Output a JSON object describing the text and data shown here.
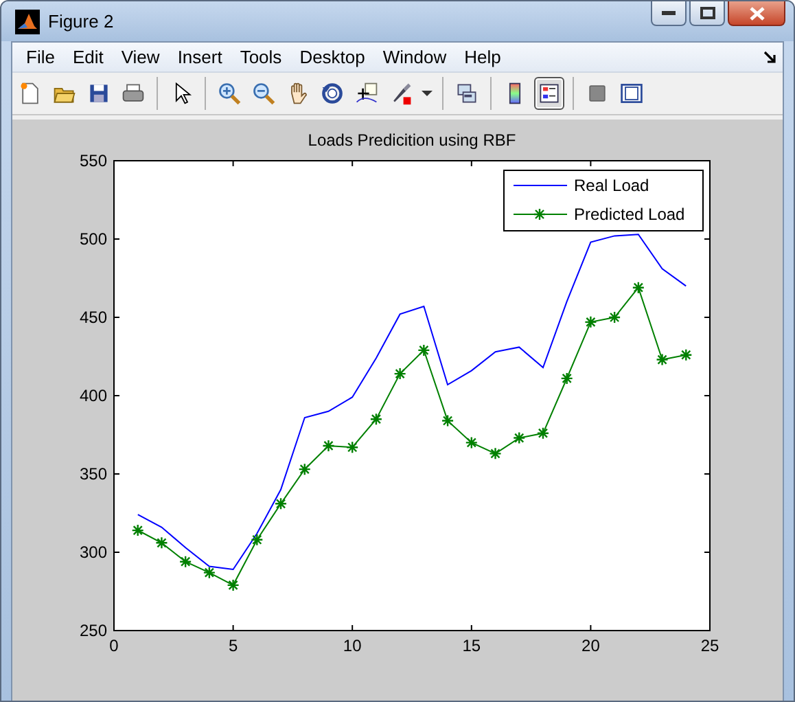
{
  "window": {
    "title": "Figure 2"
  },
  "menu": [
    "File",
    "Edit",
    "View",
    "Insert",
    "Tools",
    "Desktop",
    "Window",
    "Help"
  ],
  "toolbar": [
    {
      "kind": "new",
      "selected": false
    },
    {
      "kind": "open",
      "selected": false
    },
    {
      "kind": "save",
      "selected": false
    },
    {
      "kind": "print",
      "selected": false
    },
    {
      "kind": "sep"
    },
    {
      "kind": "pointer",
      "selected": false
    },
    {
      "kind": "sep"
    },
    {
      "kind": "zoomin",
      "selected": false
    },
    {
      "kind": "zoomout",
      "selected": false
    },
    {
      "kind": "pan",
      "selected": false
    },
    {
      "kind": "rotate",
      "selected": false
    },
    {
      "kind": "cursor",
      "selected": false
    },
    {
      "kind": "brush",
      "selected": false
    },
    {
      "kind": "caret",
      "selected": false
    },
    {
      "kind": "sep"
    },
    {
      "kind": "link",
      "selected": false
    },
    {
      "kind": "sep"
    },
    {
      "kind": "colorbar",
      "selected": false
    },
    {
      "kind": "legend",
      "selected": true
    },
    {
      "kind": "sep"
    },
    {
      "kind": "hide",
      "selected": false
    },
    {
      "kind": "show",
      "selected": false
    }
  ],
  "figure": {
    "chart_data": {
      "type": "line",
      "title": "Loads Predicition using RBF",
      "x": [
        1,
        2,
        3,
        4,
        5,
        6,
        7,
        8,
        9,
        10,
        11,
        12,
        13,
        14,
        15,
        16,
        17,
        18,
        19,
        20,
        21,
        22,
        23,
        24
      ],
      "series": [
        {
          "name": "Real Load",
          "color": "#0000ff",
          "marker": "none",
          "values": [
            324,
            316,
            303,
            291,
            289,
            312,
            340,
            386,
            390,
            399,
            424,
            452,
            457,
            407,
            416,
            428,
            431,
            418,
            460,
            498,
            502,
            503,
            481,
            470
          ]
        },
        {
          "name": "Predicted Load",
          "color": "#008000",
          "marker": "cross",
          "values": [
            314,
            306,
            294,
            287,
            279,
            308,
            331,
            353,
            368,
            367,
            385,
            414,
            429,
            384,
            370,
            363,
            373,
            376,
            411,
            447,
            450,
            469,
            423,
            426
          ]
        }
      ],
      "legend": true,
      "xlim": [
        0,
        25
      ],
      "ylim": [
        250,
        550
      ],
      "xticks": [
        0,
        5,
        10,
        15,
        20,
        25
      ],
      "yticks": [
        250,
        300,
        350,
        400,
        450,
        500,
        550
      ]
    }
  }
}
